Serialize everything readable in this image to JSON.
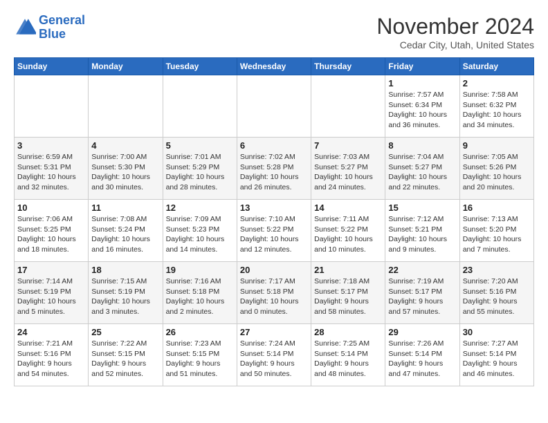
{
  "logo": {
    "line1": "General",
    "line2": "Blue"
  },
  "title": "November 2024",
  "location": "Cedar City, Utah, United States",
  "weekdays": [
    "Sunday",
    "Monday",
    "Tuesday",
    "Wednesday",
    "Thursday",
    "Friday",
    "Saturday"
  ],
  "weeks": [
    [
      {
        "day": "",
        "info": ""
      },
      {
        "day": "",
        "info": ""
      },
      {
        "day": "",
        "info": ""
      },
      {
        "day": "",
        "info": ""
      },
      {
        "day": "",
        "info": ""
      },
      {
        "day": "1",
        "info": "Sunrise: 7:57 AM\nSunset: 6:34 PM\nDaylight: 10 hours\nand 36 minutes."
      },
      {
        "day": "2",
        "info": "Sunrise: 7:58 AM\nSunset: 6:32 PM\nDaylight: 10 hours\nand 34 minutes."
      }
    ],
    [
      {
        "day": "3",
        "info": "Sunrise: 6:59 AM\nSunset: 5:31 PM\nDaylight: 10 hours\nand 32 minutes."
      },
      {
        "day": "4",
        "info": "Sunrise: 7:00 AM\nSunset: 5:30 PM\nDaylight: 10 hours\nand 30 minutes."
      },
      {
        "day": "5",
        "info": "Sunrise: 7:01 AM\nSunset: 5:29 PM\nDaylight: 10 hours\nand 28 minutes."
      },
      {
        "day": "6",
        "info": "Sunrise: 7:02 AM\nSunset: 5:28 PM\nDaylight: 10 hours\nand 26 minutes."
      },
      {
        "day": "7",
        "info": "Sunrise: 7:03 AM\nSunset: 5:27 PM\nDaylight: 10 hours\nand 24 minutes."
      },
      {
        "day": "8",
        "info": "Sunrise: 7:04 AM\nSunset: 5:27 PM\nDaylight: 10 hours\nand 22 minutes."
      },
      {
        "day": "9",
        "info": "Sunrise: 7:05 AM\nSunset: 5:26 PM\nDaylight: 10 hours\nand 20 minutes."
      }
    ],
    [
      {
        "day": "10",
        "info": "Sunrise: 7:06 AM\nSunset: 5:25 PM\nDaylight: 10 hours\nand 18 minutes."
      },
      {
        "day": "11",
        "info": "Sunrise: 7:08 AM\nSunset: 5:24 PM\nDaylight: 10 hours\nand 16 minutes."
      },
      {
        "day": "12",
        "info": "Sunrise: 7:09 AM\nSunset: 5:23 PM\nDaylight: 10 hours\nand 14 minutes."
      },
      {
        "day": "13",
        "info": "Sunrise: 7:10 AM\nSunset: 5:22 PM\nDaylight: 10 hours\nand 12 minutes."
      },
      {
        "day": "14",
        "info": "Sunrise: 7:11 AM\nSunset: 5:22 PM\nDaylight: 10 hours\nand 10 minutes."
      },
      {
        "day": "15",
        "info": "Sunrise: 7:12 AM\nSunset: 5:21 PM\nDaylight: 10 hours\nand 9 minutes."
      },
      {
        "day": "16",
        "info": "Sunrise: 7:13 AM\nSunset: 5:20 PM\nDaylight: 10 hours\nand 7 minutes."
      }
    ],
    [
      {
        "day": "17",
        "info": "Sunrise: 7:14 AM\nSunset: 5:19 PM\nDaylight: 10 hours\nand 5 minutes."
      },
      {
        "day": "18",
        "info": "Sunrise: 7:15 AM\nSunset: 5:19 PM\nDaylight: 10 hours\nand 3 minutes."
      },
      {
        "day": "19",
        "info": "Sunrise: 7:16 AM\nSunset: 5:18 PM\nDaylight: 10 hours\nand 2 minutes."
      },
      {
        "day": "20",
        "info": "Sunrise: 7:17 AM\nSunset: 5:18 PM\nDaylight: 10 hours\nand 0 minutes."
      },
      {
        "day": "21",
        "info": "Sunrise: 7:18 AM\nSunset: 5:17 PM\nDaylight: 9 hours\nand 58 minutes."
      },
      {
        "day": "22",
        "info": "Sunrise: 7:19 AM\nSunset: 5:17 PM\nDaylight: 9 hours\nand 57 minutes."
      },
      {
        "day": "23",
        "info": "Sunrise: 7:20 AM\nSunset: 5:16 PM\nDaylight: 9 hours\nand 55 minutes."
      }
    ],
    [
      {
        "day": "24",
        "info": "Sunrise: 7:21 AM\nSunset: 5:16 PM\nDaylight: 9 hours\nand 54 minutes."
      },
      {
        "day": "25",
        "info": "Sunrise: 7:22 AM\nSunset: 5:15 PM\nDaylight: 9 hours\nand 52 minutes."
      },
      {
        "day": "26",
        "info": "Sunrise: 7:23 AM\nSunset: 5:15 PM\nDaylight: 9 hours\nand 51 minutes."
      },
      {
        "day": "27",
        "info": "Sunrise: 7:24 AM\nSunset: 5:14 PM\nDaylight: 9 hours\nand 50 minutes."
      },
      {
        "day": "28",
        "info": "Sunrise: 7:25 AM\nSunset: 5:14 PM\nDaylight: 9 hours\nand 48 minutes."
      },
      {
        "day": "29",
        "info": "Sunrise: 7:26 AM\nSunset: 5:14 PM\nDaylight: 9 hours\nand 47 minutes."
      },
      {
        "day": "30",
        "info": "Sunrise: 7:27 AM\nSunset: 5:14 PM\nDaylight: 9 hours\nand 46 minutes."
      }
    ]
  ]
}
